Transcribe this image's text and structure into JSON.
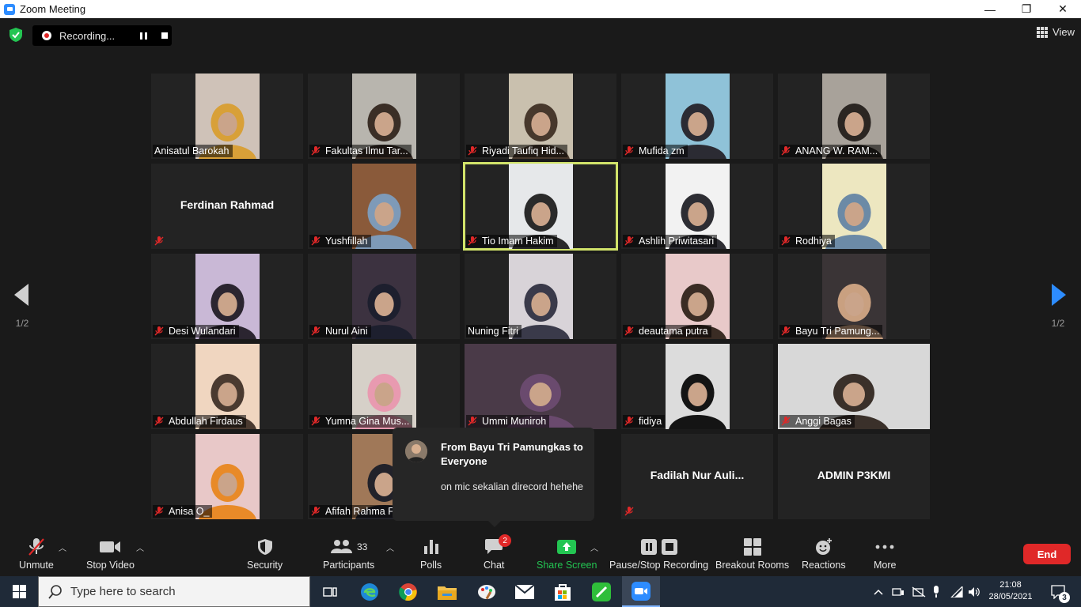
{
  "window": {
    "title": "Zoom Meeting",
    "minimize": "—",
    "restore": "❐",
    "close": "✕"
  },
  "recording": {
    "label": "Recording..."
  },
  "view": {
    "label": "View"
  },
  "pager": {
    "left": "1/2",
    "right": "1/2"
  },
  "tiles": [
    {
      "name": "Anisatul Barokah",
      "muted": false,
      "has_video": true,
      "bg": "#cfc2b8",
      "fig": "#d8a038"
    },
    {
      "name": "Fakultas Ilmu Tar...",
      "muted": true,
      "has_video": true,
      "bg": "#b8b5ae",
      "fig": "#3a2e26"
    },
    {
      "name": "Riyadi Taufiq Hid...",
      "muted": true,
      "has_video": true,
      "bg": "#c9c0ae",
      "fig": "#47382c"
    },
    {
      "name": "Mufida zm",
      "muted": true,
      "has_video": true,
      "bg": "#8fc2d8",
      "fig": "#2b2b33"
    },
    {
      "name": "ANANG W. RAM...",
      "muted": true,
      "has_video": true,
      "bg": "#a8a29a",
      "fig": "#2b2622"
    },
    {
      "name": "Ferdinan Rahmad",
      "muted": true,
      "has_video": false,
      "bg": "",
      "fig": ""
    },
    {
      "name": "Yushfillah",
      "muted": true,
      "has_video": true,
      "bg": "#8a5a3a",
      "fig": "#7e9ab8"
    },
    {
      "name": "Tio Imam Hakim",
      "muted": true,
      "has_video": true,
      "bg": "#e6e8ea",
      "fig": "#2a2a2a",
      "active": true
    },
    {
      "name": "Ashlih Priwitasari",
      "muted": true,
      "has_video": true,
      "bg": "#f2f2f2",
      "fig": "#2d2d33"
    },
    {
      "name": "Rodhiya",
      "muted": true,
      "has_video": true,
      "bg": "#ede7c0",
      "fig": "#6c8aa6"
    },
    {
      "name": "Desi Wulandari",
      "muted": true,
      "has_video": true,
      "bg": "#c9b8d6",
      "fig": "#2b2530"
    },
    {
      "name": "Nurul Aini",
      "muted": true,
      "has_video": true,
      "bg": "#3c3240",
      "fig": "#1d1f2e"
    },
    {
      "name": "Nuning Fitri",
      "muted": false,
      "has_video": true,
      "bg": "#d8d3d8",
      "fig": "#3a3a4a"
    },
    {
      "name": "deautama putra",
      "muted": true,
      "has_video": true,
      "bg": "#e8c9c9",
      "fig": "#3a2c24"
    },
    {
      "name": "Bayu Tri Pamung...",
      "muted": true,
      "has_video": true,
      "bg": "#3a3436",
      "fig": "#c9a080"
    },
    {
      "name": "Abdullah Firdaus",
      "muted": true,
      "has_video": true,
      "bg": "#f0d6c0",
      "fig": "#4a3a30"
    },
    {
      "name": "Yumna Gina Mus...",
      "muted": true,
      "has_video": true,
      "bg": "#d6d0c8",
      "fig": "#e89ab0"
    },
    {
      "name": "Ummi Muniroh",
      "muted": true,
      "has_video": true,
      "bg": "#4a3a48",
      "fig": "#6a4a6e",
      "full": true
    },
    {
      "name": "fidiya",
      "muted": true,
      "has_video": true,
      "bg": "#dcdcdc",
      "fig": "#141414"
    },
    {
      "name": "Anggi Bagas",
      "muted": true,
      "has_video": true,
      "bg": "#d8d8d8",
      "fig": "#3a302a",
      "full": true
    },
    {
      "name": "Anisa O_",
      "muted": true,
      "has_video": true,
      "bg": "#e8c8c8",
      "fig": "#e88a28"
    },
    {
      "name": "Afifah Rahma F",
      "muted": true,
      "has_video": true,
      "bg": "#a07858",
      "fig": "#22222a"
    },
    {
      "name": "",
      "muted": false,
      "has_video": false,
      "bg": "",
      "fig": "",
      "hidden": true
    },
    {
      "name": "Fadilah Nur Auli...",
      "muted": true,
      "has_video": false,
      "bg": "",
      "fig": ""
    },
    {
      "name": "ADMIN P3KMI",
      "muted": false,
      "has_video": false,
      "bg": "",
      "fig": ""
    }
  ],
  "chat_popup": {
    "from": "From Bayu Tri Pamungkas to Everyone",
    "message": "on mic sekalian direcord hehehe"
  },
  "toolbar": {
    "unmute": "Unmute",
    "stop_video": "Stop Video",
    "security": "Security",
    "participants": "Participants",
    "participants_count": "33",
    "polls": "Polls",
    "chat": "Chat",
    "chat_badge": "2",
    "share_screen": "Share Screen",
    "pause_stop_recording": "Pause/Stop Recording",
    "breakout_rooms": "Breakout Rooms",
    "reactions": "Reactions",
    "more": "More",
    "end": "End"
  },
  "taskbar": {
    "search_placeholder": "Type here to search",
    "time": "21:08",
    "date": "28/05/2021",
    "notifications": "3"
  },
  "colors": {
    "share_green": "#23c552",
    "end_red": "#e02828",
    "active_speaker": "#d1e36a",
    "zoom_blue": "#2d8cff"
  }
}
